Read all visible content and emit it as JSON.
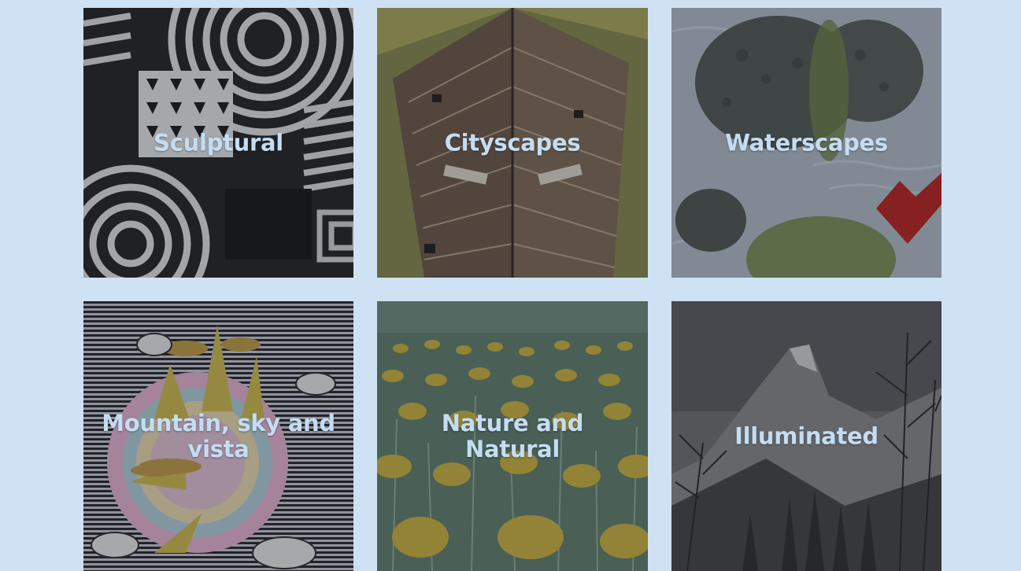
{
  "gallery": {
    "tiles": [
      {
        "label": "Sculptural",
        "image": "black-white-op-art-sculpture"
      },
      {
        "label": "Cityscapes",
        "image": "stone-tower-from-below"
      },
      {
        "label": "Waterscapes",
        "image": "lily-pads-on-water"
      },
      {
        "label": "Mountain, sky and vista",
        "image": "psychedelic-sun-striped-background"
      },
      {
        "label": "Nature and Natural",
        "image": "dandelion-field"
      },
      {
        "label": "Illuminated",
        "image": "snowy-mountain-forest"
      }
    ]
  },
  "colors": {
    "background": "#cfe2f3",
    "label_text": "#c4ddf3"
  }
}
